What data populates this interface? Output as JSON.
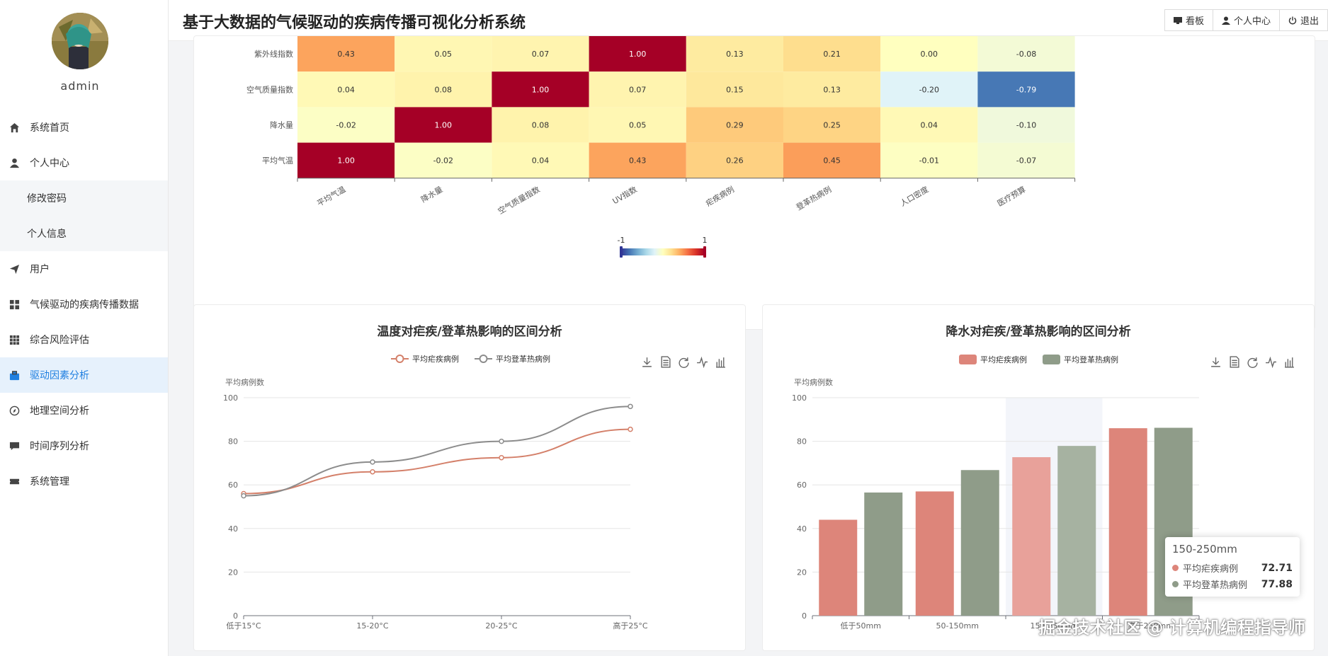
{
  "app": {
    "title": "基于大数据的气候驱动的疾病传播可视化分析系统",
    "username": "admin",
    "watermark": "掘金技术社区 @ 计算机编程指导师"
  },
  "header": {
    "buttons": [
      {
        "label": "看板",
        "icon": "monitor-icon"
      },
      {
        "label": "个人中心",
        "icon": "user-icon"
      },
      {
        "label": "退出",
        "icon": "power-icon"
      }
    ]
  },
  "sidebar": {
    "items": [
      {
        "label": "系统首页",
        "icon": "home-icon"
      },
      {
        "label": "个人中心",
        "icon": "user-icon"
      },
      {
        "label": "修改密码",
        "sub": true
      },
      {
        "label": "个人信息",
        "sub": true
      },
      {
        "label": "用户",
        "icon": "send-icon"
      },
      {
        "label": "气候驱动的疾病传播数据",
        "icon": "grid-icon"
      },
      {
        "label": "综合风险评估",
        "icon": "apps-icon"
      },
      {
        "label": "驱动因素分析",
        "icon": "briefcase-icon",
        "active": true
      },
      {
        "label": "地理空间分析",
        "icon": "compass-icon"
      },
      {
        "label": "时间序列分析",
        "icon": "chat-icon"
      },
      {
        "label": "系统管理",
        "icon": "ticket-icon"
      }
    ]
  },
  "chart_data": [
    {
      "type": "heatmap",
      "x_labels": [
        "平均气温",
        "降水量",
        "空气质量指数",
        "UV指数",
        "疟疾病例",
        "登革热病例",
        "人口密度",
        "医疗预算"
      ],
      "y_labels": [
        "紫外线指数",
        "空气质量指数",
        "降水量",
        "平均气温"
      ],
      "values": [
        [
          0.43,
          0.05,
          0.07,
          1.0,
          0.13,
          0.21,
          0.0,
          -0.08
        ],
        [
          0.04,
          0.08,
          1.0,
          0.07,
          0.15,
          0.13,
          -0.2,
          -0.79
        ],
        [
          -0.02,
          1.0,
          0.08,
          0.05,
          0.29,
          0.25,
          0.04,
          -0.1
        ],
        [
          1.0,
          -0.02,
          0.04,
          0.43,
          0.26,
          0.45,
          -0.01,
          -0.07
        ]
      ],
      "visual_map": {
        "min": -1,
        "max": 1,
        "min_label": "-1",
        "max_label": "1"
      }
    },
    {
      "type": "line",
      "title": "温度对疟疾/登革热影响的区间分析",
      "categories": [
        "低于15°C",
        "15-20°C",
        "20-25°C",
        "高于25°C"
      ],
      "ylabel": "平均病例数",
      "ylim": [
        0,
        100
      ],
      "yticks": [
        0,
        20,
        40,
        60,
        80,
        100
      ],
      "series": [
        {
          "name": "平均疟疾病例",
          "color": "#d4806a",
          "values": [
            56,
            66,
            72.5,
            85.5
          ]
        },
        {
          "name": "平均登革热病例",
          "color": "#8c8c8c",
          "values": [
            55,
            70.5,
            80,
            96
          ]
        }
      ]
    },
    {
      "type": "bar",
      "title": "降水对疟疾/登革热影响的区间分析",
      "categories": [
        "低于50mm",
        "50-150mm",
        "150-250mm",
        "高于250mm"
      ],
      "ylabel": "平均病例数",
      "ylim": [
        0,
        100
      ],
      "yticks": [
        0,
        20,
        40,
        60,
        80,
        100
      ],
      "series": [
        {
          "name": "平均疟疾病例",
          "color": "#dd857a",
          "values": [
            44,
            57,
            72.71,
            86
          ]
        },
        {
          "name": "平均登革热病例",
          "color": "#8f9c89",
          "values": [
            56.5,
            66.8,
            77.88,
            86.2
          ]
        }
      ],
      "highlight_index": 2
    }
  ],
  "tooltip": {
    "title": "150-250mm",
    "rows": [
      {
        "name": "平均疟疾病例",
        "value": "72.71",
        "color": "#dd857a"
      },
      {
        "name": "平均登革热病例",
        "value": "77.88",
        "color": "#8f9c89"
      }
    ]
  },
  "toolbox": [
    "download-icon",
    "data-view-icon",
    "refresh-icon",
    "line-switch-icon",
    "bar-switch-icon"
  ]
}
